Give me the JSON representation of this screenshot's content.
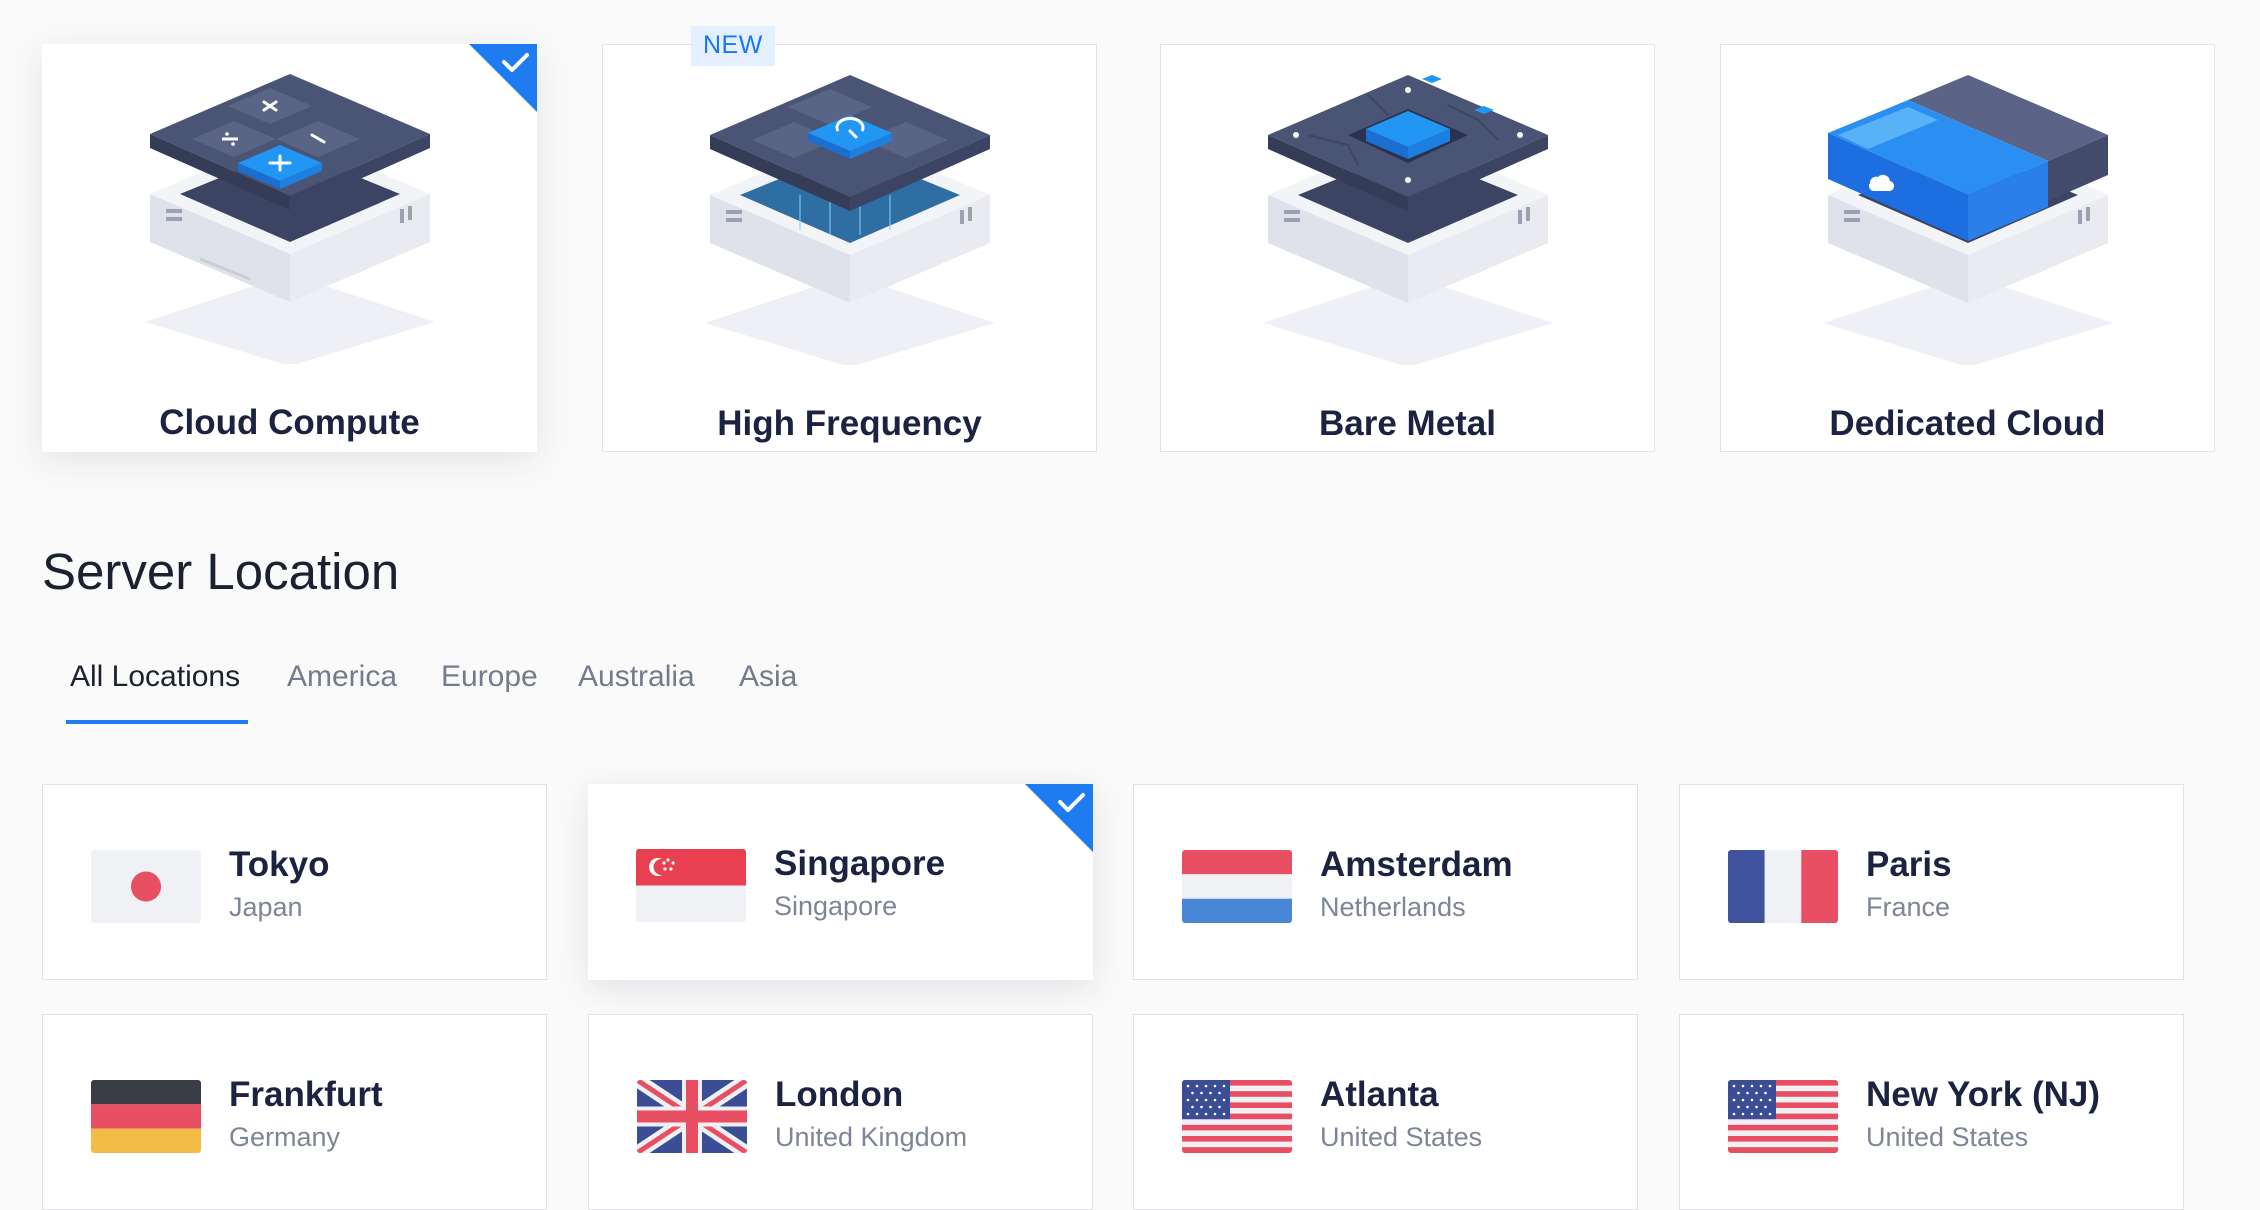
{
  "products": [
    {
      "name": "Cloud Compute",
      "selected": true
    },
    {
      "name": "High Frequency",
      "badge": "NEW"
    },
    {
      "name": "Bare Metal"
    },
    {
      "name": "Dedicated Cloud"
    }
  ],
  "section_title": "Server Location",
  "tabs": [
    "All Locations",
    "America",
    "Europe",
    "Australia",
    "Asia"
  ],
  "active_tab": "All Locations",
  "locations": [
    {
      "city": "Tokyo",
      "country": "Japan",
      "flag": "japan-flag"
    },
    {
      "city": "Singapore",
      "country": "Singapore",
      "flag": "singapore-flag",
      "selected": true
    },
    {
      "city": "Amsterdam",
      "country": "Netherlands",
      "flag": "netherlands-flag"
    },
    {
      "city": "Paris",
      "country": "France",
      "flag": "france-flag"
    },
    {
      "city": "Frankfurt",
      "country": "Germany",
      "flag": "germany-flag"
    },
    {
      "city": "London",
      "country": "United Kingdom",
      "flag": "uk-flag"
    },
    {
      "city": "Atlanta",
      "country": "United States",
      "flag": "us-flag"
    },
    {
      "city": "New York (NJ)",
      "country": "United States",
      "flag": "us-flag"
    }
  ],
  "colors": {
    "accent": "#1e7cf0",
    "badge_bg": "#e4efff",
    "title": "#1b2340",
    "muted": "#7d8596"
  }
}
